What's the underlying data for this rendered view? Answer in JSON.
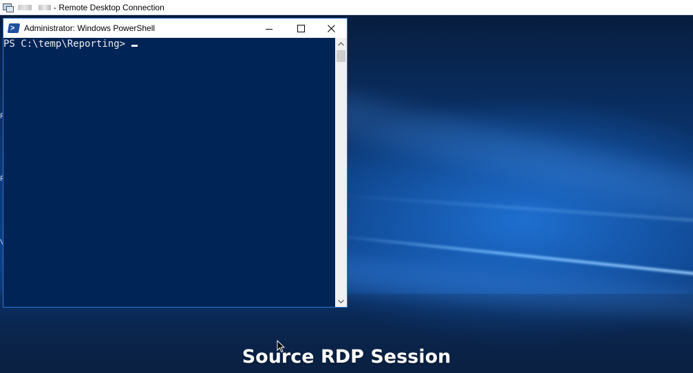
{
  "rdp": {
    "title": "- Remote Desktop Connection"
  },
  "powershell": {
    "title": "Administrator: Windows PowerShell",
    "icon": "powershell-icon",
    "prompt": "PS C:\\temp\\Reporting> ",
    "buttons": {
      "minimize": "minimize-icon",
      "maximize": "maximize-icon",
      "close": "close-icon"
    },
    "background_color": "#012456",
    "text_color": "#eeedf0"
  },
  "caption": "Source RDP Session",
  "desktop_edge_glyphs": [
    "F",
    "F",
    "V"
  ]
}
